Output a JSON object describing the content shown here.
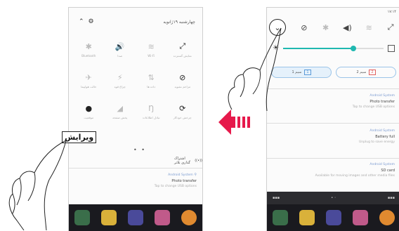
{
  "left_phone": {
    "status_time": "۱۷:۱۴",
    "header_title": "چهارشنبه ۱۹ژانویه",
    "tiles": [
      {
        "name": "bluetooth-icon",
        "icon": "✱",
        "label": "Bluetooth",
        "on": false
      },
      {
        "name": "sound-icon",
        "icon": "🔊",
        "label": "صدا",
        "on": true
      },
      {
        "name": "wifi-icon",
        "icon": "≋",
        "label": "Wi-Fi",
        "on": false
      },
      {
        "name": "expand-icon",
        "icon": "⤢",
        "label": "نمایش گسترده",
        "on": true
      },
      {
        "name": "airplane-icon",
        "icon": "✈",
        "label": "حالت هواپیما",
        "on": false
      },
      {
        "name": "flashlight-icon",
        "icon": "⚡",
        "label": "چراغ قوه",
        "on": false
      },
      {
        "name": "data-icon",
        "icon": "⇅",
        "label": "داده ها",
        "on": false
      },
      {
        "name": "nodisturb-icon",
        "icon": "⊘",
        "label": "مزاحم نشوید",
        "on": true
      },
      {
        "name": "location-icon",
        "icon": "●",
        "label": "موقعیت",
        "on": true
      },
      {
        "name": "cast-icon",
        "icon": "◢",
        "label": "پخش صفحه",
        "on": false
      },
      {
        "name": "nfc-icon",
        "icon": "Ŋ",
        "label": "تبادل اطلاعات",
        "on": false
      },
      {
        "name": "rotate-icon",
        "icon": "⟳",
        "label": "چرخش خودکار",
        "on": true
      }
    ],
    "page_dots": "• •",
    "edit_label": "ویرایش",
    "hotspot_label": "اشتراک گذاری بلاتر",
    "notification": {
      "app": "Android System",
      "title": "Photo transfer",
      "subtitle": "Tap to change USB options"
    }
  },
  "right_phone": {
    "status_time": "۱۷:۱۴",
    "sim1_label": "سیم 1",
    "sim1_num": "1",
    "sim2_label": "سیم 2",
    "sim2_num": "2",
    "brightness_percent": 70,
    "notifications": [
      {
        "app": "Android System",
        "title": "Photo transfer",
        "subtitle": "Tap to change USB options"
      },
      {
        "app": "Android System",
        "title": "Battery full",
        "subtitle": "Unplug to save energy"
      },
      {
        "app": "Android System",
        "title": "SD card",
        "subtitle": "Available for moving images and other media files"
      }
    ]
  },
  "colors": {
    "arrow": "#e6194b",
    "accent": "#1fb8b0"
  }
}
